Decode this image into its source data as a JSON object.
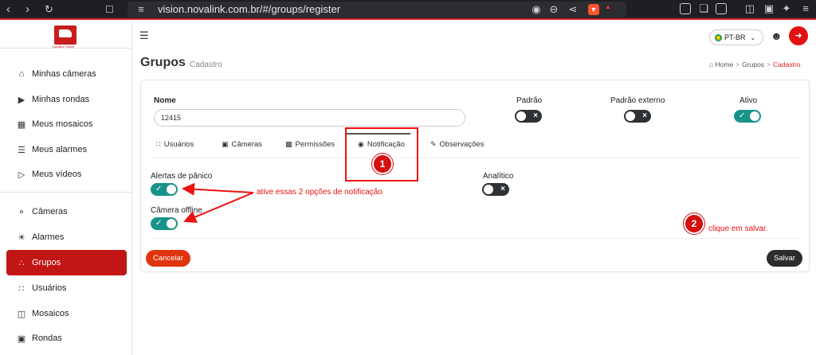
{
  "browser": {
    "url": "vision.novalink.com.br/#/groups/register",
    "brave_badge": "0"
  },
  "app": {
    "logo_caption": "Novalink Vision"
  },
  "sidebar": {
    "items": [
      {
        "label": "Minhas câmeras",
        "icon": "home-icon"
      },
      {
        "label": "Minhas rondas",
        "icon": "play-square-icon"
      },
      {
        "label": "Meus mosaicos",
        "icon": "grid-icon"
      },
      {
        "label": "Meus alarmes",
        "icon": "alarm-icon"
      },
      {
        "label": "Meus vídeos",
        "icon": "play-circle-icon"
      },
      {
        "label": "Câmeras",
        "icon": "camera-icon"
      },
      {
        "label": "Alarmes",
        "icon": "siren-icon"
      },
      {
        "label": "Grupos",
        "icon": "group-icon",
        "active": true
      },
      {
        "label": "Usuários",
        "icon": "users-icon"
      },
      {
        "label": "Mosaicos",
        "icon": "mosaic-icon"
      },
      {
        "label": "Rondas",
        "icon": "rondas-icon"
      }
    ]
  },
  "header": {
    "language": "PT-BR"
  },
  "page": {
    "title": "Grupos",
    "subtitle": "Cadastro",
    "breadcrumb": [
      "Home",
      "Grupos",
      "Cadastro"
    ]
  },
  "form": {
    "name_label": "Nome",
    "name_value": "12415",
    "padrao_label": "Padrão",
    "padrao_externo_label": "Padrão externo",
    "ativo_label": "Ativo",
    "padrao_on": false,
    "padrao_externo_on": false,
    "ativo_on": true
  },
  "tabs": [
    {
      "label": "Usuários",
      "icon": "users-icon"
    },
    {
      "label": "Câmeras",
      "icon": "camera-icon"
    },
    {
      "label": "Permissões",
      "icon": "lock-icon"
    },
    {
      "label": "Notificação",
      "icon": "bell-icon",
      "active": true
    },
    {
      "label": "Observações",
      "icon": "pencil-icon"
    }
  ],
  "notifications": {
    "panic_label": "Alertas de pânico",
    "panic_on": true,
    "offline_label": "Câmera offline",
    "offline_on": true,
    "analytic_label": "Analítico",
    "analytic_on": false
  },
  "buttons": {
    "cancel": "Cancelar",
    "save": "Salvar"
  },
  "annotations": {
    "badge1": "1",
    "badge2": "2",
    "note_activate": "ative essas 2 opções de notificação",
    "note_save": "clique em salvar."
  },
  "colors": {
    "brand_red": "#c21515",
    "toggle_on": "#18938a",
    "toggle_off": "#2e3136",
    "cancel": "#e0340f",
    "annotation": "#e11111"
  }
}
